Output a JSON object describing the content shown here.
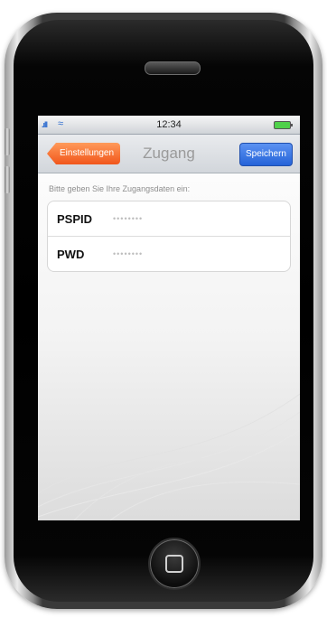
{
  "status_bar": {
    "signal_icon": "signal-bars-icon",
    "wifi_icon": "wifi-icon",
    "time": "12:34",
    "battery_icon": "battery-icon"
  },
  "nav": {
    "back_label": "Einstellungen",
    "title": "Zugang",
    "save_label": "Speichern"
  },
  "form": {
    "hint": "Bitte geben Sie Ihre Zugangsdaten ein:",
    "fields": [
      {
        "label": "PSPID",
        "value": "",
        "placeholder": "••••••••"
      },
      {
        "label": "PWD",
        "value": "",
        "placeholder": "••••••••"
      }
    ]
  },
  "colors": {
    "back_button": "#f1561b",
    "save_button": "#2563d8",
    "title": "#9a9a9a"
  }
}
